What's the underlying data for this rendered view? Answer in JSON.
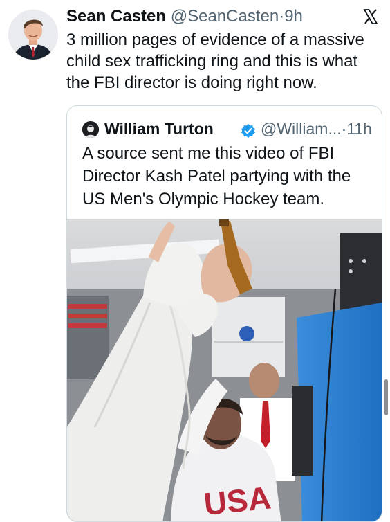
{
  "tweet": {
    "author_name": "Sean Casten",
    "author_handle": "@SeanCasten",
    "separator": "·",
    "time": "9h",
    "text": "3 million pages of evidence of a massive child sex trafficking ring and this is what the FBI director is doing right now."
  },
  "quoted_tweet": {
    "author_name": "William Turton",
    "verified": true,
    "author_handle": "@William...",
    "separator": "·",
    "time": "11h",
    "text": "A source sent me this video of FBI Director Kash Patel partying with the US Men's Olympic Hockey team."
  },
  "media": {
    "jersey_text": "USA"
  },
  "icons": {
    "platform_logo": "x-logo-icon",
    "verified_badge": "verified-badge-icon"
  },
  "colors": {
    "text_primary": "#0f1419",
    "text_secondary": "#536471",
    "border": "#cfd9de",
    "verified_blue": "#1d9bf0"
  }
}
